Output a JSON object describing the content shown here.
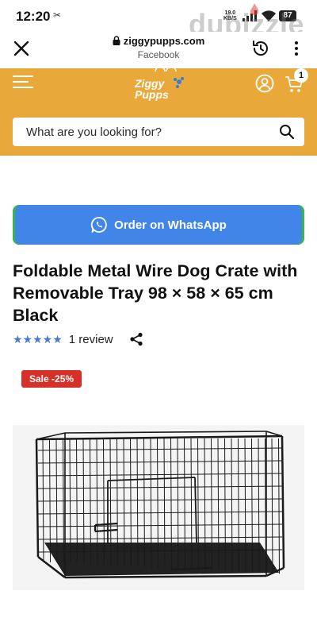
{
  "status_bar": {
    "time": "12:20",
    "extra_icon": "✂",
    "net_speed_value": "19.0",
    "net_speed_unit": "KB/S",
    "battery": "87",
    "watermark": "dubizzle"
  },
  "browser": {
    "url": "ziggypupps.com",
    "source": "Facebook"
  },
  "site": {
    "logo_line1": "Ziggy",
    "logo_line2": "Pupps",
    "cart_count": "1",
    "brand_color": "#e9a93a",
    "search_placeholder": "What are you looking for?"
  },
  "product": {
    "whatsapp_label": "Order on WhatsApp",
    "title": "Foldable Metal Wire Dog Crate with Removable Tray 98 × 58 × 65 cm Black",
    "rating_stars": "★★★★★",
    "rating_value": 5,
    "review_label": "1 review",
    "sale_badge": "Sale -25%",
    "sale_color": "#d63028",
    "whatsapp_color": "#4285e8"
  },
  "icons": {
    "close": "close-icon",
    "history": "history-icon",
    "more": "more-vertical-icon",
    "menu": "hamburger-menu-icon",
    "account": "account-icon",
    "cart": "cart-icon",
    "search": "search-icon",
    "whatsapp": "whatsapp-icon",
    "share": "share-icon"
  }
}
